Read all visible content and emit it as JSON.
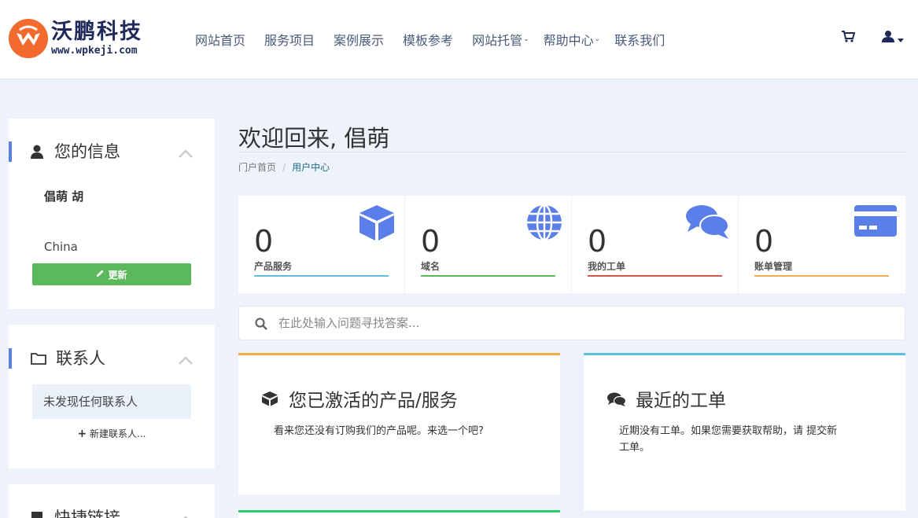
{
  "brand": {
    "name_cn": "沃鹏科技",
    "url": "www.wpkeji.com",
    "color": "#f26a2e"
  },
  "nav": {
    "items": [
      {
        "label": "网站首页"
      },
      {
        "label": "服务项目"
      },
      {
        "label": "案例展示"
      },
      {
        "label": "模板参考"
      },
      {
        "label": "网站托管"
      },
      {
        "label": "帮助中心"
      },
      {
        "label": "联系我们"
      }
    ],
    "icons": [
      "cart-icon",
      "user-icon"
    ]
  },
  "sidebar": {
    "info": {
      "title": "您的信息",
      "name": "倡萌 胡",
      "country": "China",
      "update_label": "更新"
    },
    "contacts": {
      "title": "联系人",
      "empty_label": "未发现任何联系人",
      "new_label": "新建联系人..."
    },
    "shortcuts": {
      "title": "快捷链接"
    }
  },
  "main": {
    "welcome": "欢迎回来, 倡萌",
    "breadcrumb": {
      "home": "门户首页",
      "current": "用户中心"
    },
    "stats": [
      {
        "value": "0",
        "label": "产品服务",
        "color": "#5bc0de",
        "icon": "box-icon"
      },
      {
        "value": "0",
        "label": "域名",
        "color": "#5cb85c",
        "icon": "globe-icon"
      },
      {
        "value": "0",
        "label": "我的工单",
        "color": "#d9534f",
        "icon": "comments-icon"
      },
      {
        "value": "0",
        "label": "账单管理",
        "color": "#f0ad4e",
        "icon": "credit-card-icon"
      }
    ],
    "search": {
      "placeholder": "在此处输入问题寻找答案..."
    },
    "cards": {
      "products": {
        "title": "您已激活的产品/服务",
        "text": "看来您还没有订购我们的产品呢。来选一个吧?",
        "accent": "#f0ad4e"
      },
      "tickets": {
        "title": "最近的工单",
        "text_line1": "近期没有工单。如果您需要获取帮助，请 提交新",
        "text_line2": "工单。",
        "accent": "#5bc0de"
      }
    }
  },
  "colors": {
    "accent_blue": "#5b7fe8",
    "success": "#5cb85c",
    "background": "#eef3fb"
  }
}
